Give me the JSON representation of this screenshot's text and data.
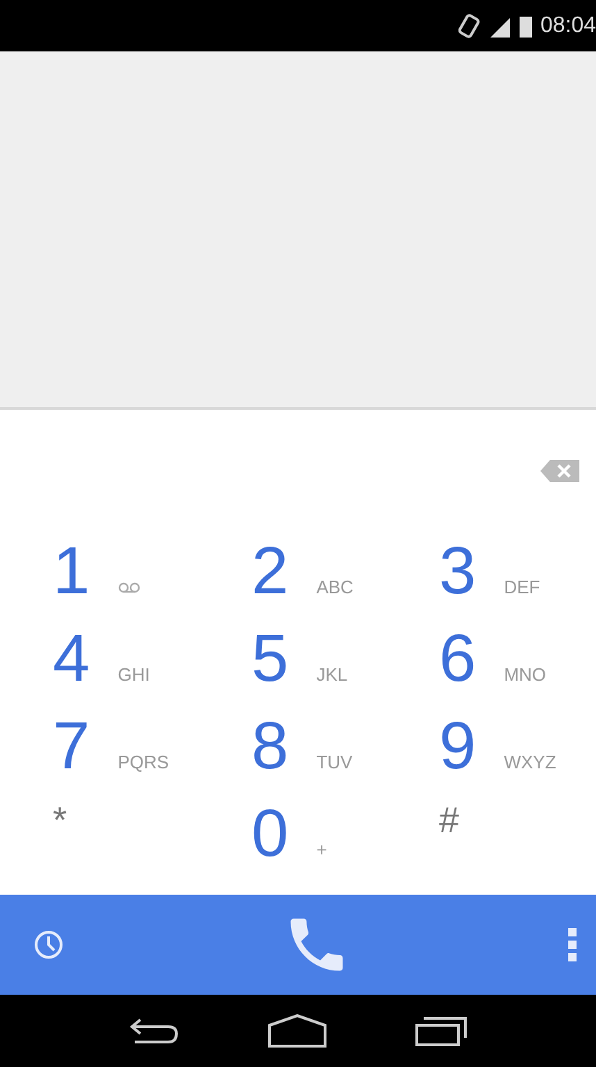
{
  "status_bar": {
    "time": "08:04"
  },
  "keys": [
    {
      "kind": "voicemail",
      "digit": "1"
    },
    {
      "kind": "letters",
      "digit": "2",
      "letters": "ABC"
    },
    {
      "kind": "letters",
      "digit": "3",
      "letters": "DEF"
    },
    {
      "kind": "letters",
      "digit": "4",
      "letters": "GHI"
    },
    {
      "kind": "letters",
      "digit": "5",
      "letters": "JKL"
    },
    {
      "kind": "letters",
      "digit": "6",
      "letters": "MNO"
    },
    {
      "kind": "letters",
      "digit": "7",
      "letters": "PQRS"
    },
    {
      "kind": "letters",
      "digit": "8",
      "letters": "TUV"
    },
    {
      "kind": "letters",
      "digit": "9",
      "letters": "WXYZ"
    },
    {
      "kind": "symbol",
      "digit": "*"
    },
    {
      "kind": "letters",
      "digit": "0",
      "letters": "+"
    },
    {
      "kind": "symbol",
      "digit": "#"
    }
  ]
}
